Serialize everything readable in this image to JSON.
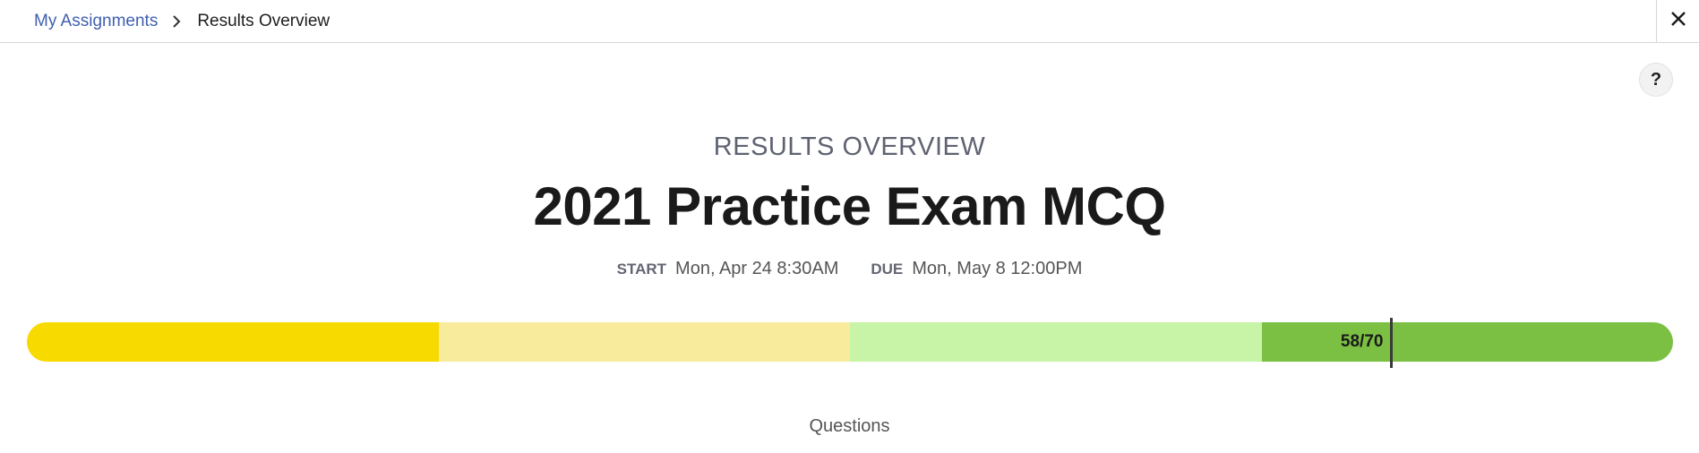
{
  "breadcrumb": {
    "parent": "My Assignments",
    "current": "Results Overview"
  },
  "header": {
    "kicker": "RESULTS OVERVIEW",
    "title": "2021 Practice Exam MCQ"
  },
  "dates": {
    "start_label": "START",
    "start_value": "Mon, Apr 24 8:30AM",
    "due_label": "DUE",
    "due_value": "Mon, May 8 12:00PM"
  },
  "score": {
    "label": "58/70",
    "earned": 58,
    "total": 70
  },
  "progress_segments": [
    {
      "color": "#f7da00"
    },
    {
      "color": "#f8eb9c"
    },
    {
      "color": "#c7f4a7"
    },
    {
      "color": "#7bc043"
    }
  ],
  "help": {
    "label": "?"
  },
  "questions_label": "Questions",
  "icons": {
    "close": "close-icon",
    "chevron": "chevron-right-icon",
    "help": "help-icon"
  }
}
